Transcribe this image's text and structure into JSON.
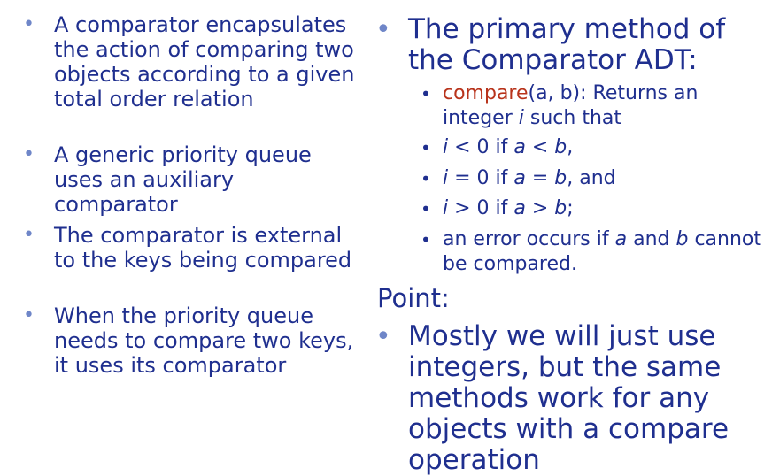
{
  "left": {
    "b1": "A comparator encapsulates the action of comparing two objects according to a given total order relation",
    "b2": "A generic priority queue uses an auxiliary comparator",
    "b3": "The comparator is external to the keys being compared",
    "b4": "When the priority queue needs to compare two keys, it uses its comparator"
  },
  "right": {
    "title": "The primary method of the Comparator ADT:",
    "compare_name": "compare",
    "compare_rest": "(a, b): Returns an integer ",
    "i": "i",
    "such_that": " such that",
    "point_label": "Point:",
    "point_text": "Mostly we will just use integers, but the same methods work for any objects with a compare operation"
  }
}
